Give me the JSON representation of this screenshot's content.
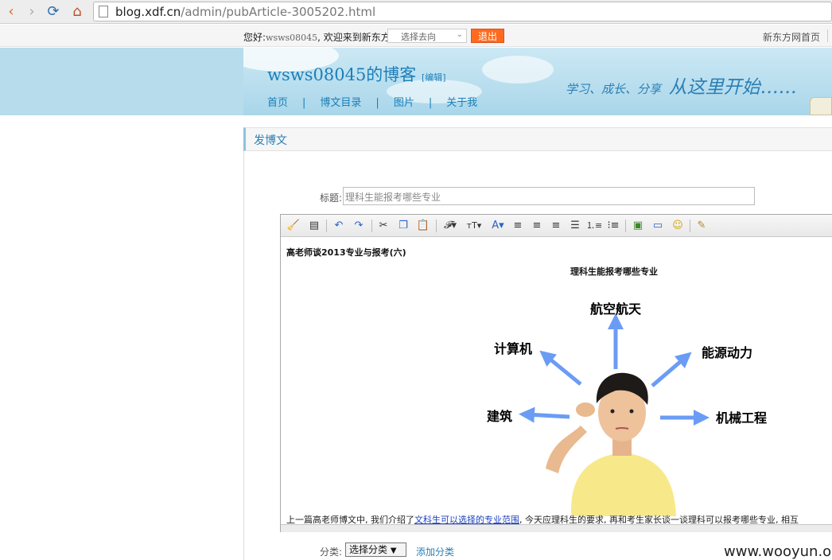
{
  "browser": {
    "url_domain": "blog.xdf.cn",
    "url_path": "/admin/pubArticle-3005202.html"
  },
  "topbar": {
    "greeting_prefix": "您好:",
    "username": "wsws08045",
    "greeting_suffix": ", 欢迎来到新东方",
    "select_placeholder": "选择去向",
    "logout_label": "退出",
    "home_link": "新东方网首页"
  },
  "banner": {
    "blog_title": "wsws08045的博客",
    "edit_label": "[编辑]",
    "slogan_small": "学习、成长、分享",
    "slogan_big": "从这里开始……",
    "menu": [
      "首页",
      "博文目录",
      "图片",
      "关于我"
    ]
  },
  "section": {
    "title": "发博文"
  },
  "form": {
    "title_label": "标题:",
    "title_value": "理科生能报考哪些专业",
    "category_label": "分类:",
    "category_value": "选择分类",
    "add_category": "添加分类"
  },
  "editor": {
    "doc_title": "高老师谈2013专业与报考(六)",
    "image_title": "理科生能报考哪些专业",
    "image_labels": {
      "top": "航空航天",
      "upper_left": "计算机",
      "upper_right": "能源动力",
      "left": "建筑",
      "right": "机械工程"
    },
    "body_before": "上一篇高老师博文中, 我们介绍了",
    "body_link": "文科生可以选择的专业范围",
    "body_after": ", 今天应理科生的要求, 再和考生家长谈一谈理科可以报考哪些专业, 相互"
  },
  "watermark": "www.wooyun.org",
  "colors": {
    "accent": "#1b7fb8",
    "logout": "#ff6a1f",
    "arrow": "#6b9cf5",
    "shirt": "#f7e98a"
  }
}
